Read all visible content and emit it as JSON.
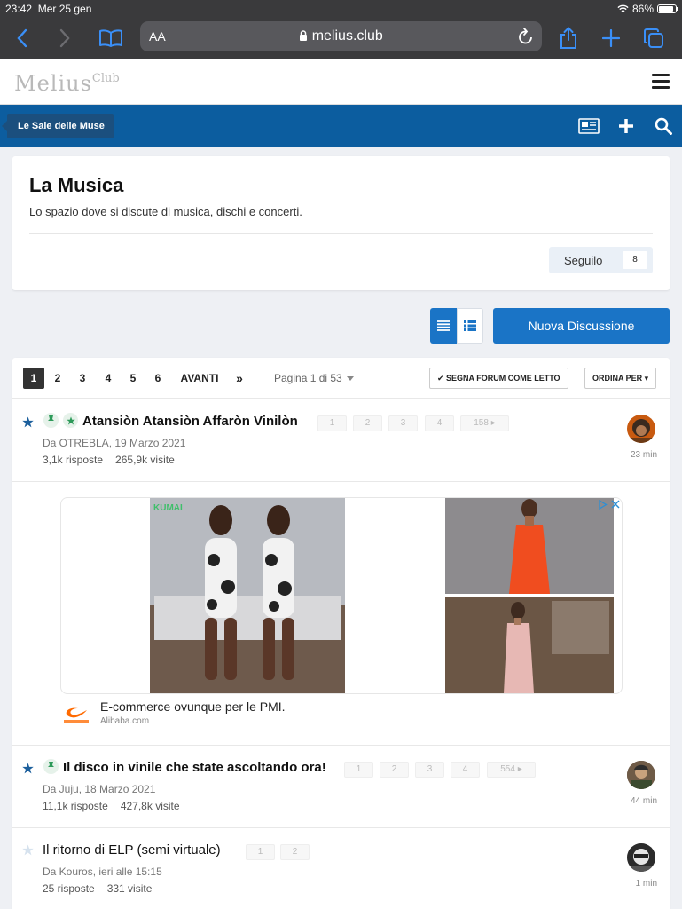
{
  "status": {
    "time": "23:42",
    "date": "Mer 25 gen",
    "battery": "86%"
  },
  "browser": {
    "text_size": "AA",
    "domain": "melius.club"
  },
  "site": {
    "logo_main": "Melius",
    "logo_sup": "Club"
  },
  "breadcrumb": "Le Sale delle Muse",
  "forum": {
    "title": "La Musica",
    "description": "Lo spazio dove si discute di musica, dischi e concerti.",
    "follow_label": "Seguilo",
    "follow_count": "8"
  },
  "new_discussion": "Nuova Discussione",
  "pagination": {
    "pages": [
      "1",
      "2",
      "3",
      "4",
      "5",
      "6"
    ],
    "current": "1",
    "next": "AVANTI",
    "last": "»",
    "info": "Pagina 1 di 53",
    "mark_read": "✔ SEGNA FORUM COME LETTO",
    "sort": "ORDINA PER ▾"
  },
  "topics": [
    {
      "title": "Atansiòn Atansiòn Affaròn Vinilòn",
      "meta": "Da OTREBLA, 19 Marzo 2021",
      "replies": "3,1k risposte",
      "views": "265,9k visite",
      "time": "23 min",
      "pages": [
        "1",
        "2",
        "3",
        "4",
        "158 ▸"
      ]
    },
    {
      "title": "Il disco in vinile che state ascoltando ora!",
      "meta": "Da Juju, 18 Marzo 2021",
      "replies": "11,1k risposte",
      "views": "427,8k visite",
      "time": "44 min",
      "pages": [
        "1",
        "2",
        "3",
        "4",
        "554 ▸"
      ]
    },
    {
      "title": "Il ritorno di ELP (semi virtuale)",
      "meta": "Da Kouros, ieri alle 15:15",
      "replies": "25 risposte",
      "views": "331 visite",
      "time": "1 min",
      "pages": [
        "1",
        "2"
      ]
    }
  ],
  "ad": {
    "headline": "E-commerce ovunque per le PMI.",
    "source": "Alibaba.com",
    "brand_mark": "KUMAI"
  },
  "colors": {
    "brand_blue": "#0c5d9f",
    "button_blue": "#1a74c6",
    "pin_green": "#2e9a5a",
    "star_blue": "#1c5f9c"
  }
}
